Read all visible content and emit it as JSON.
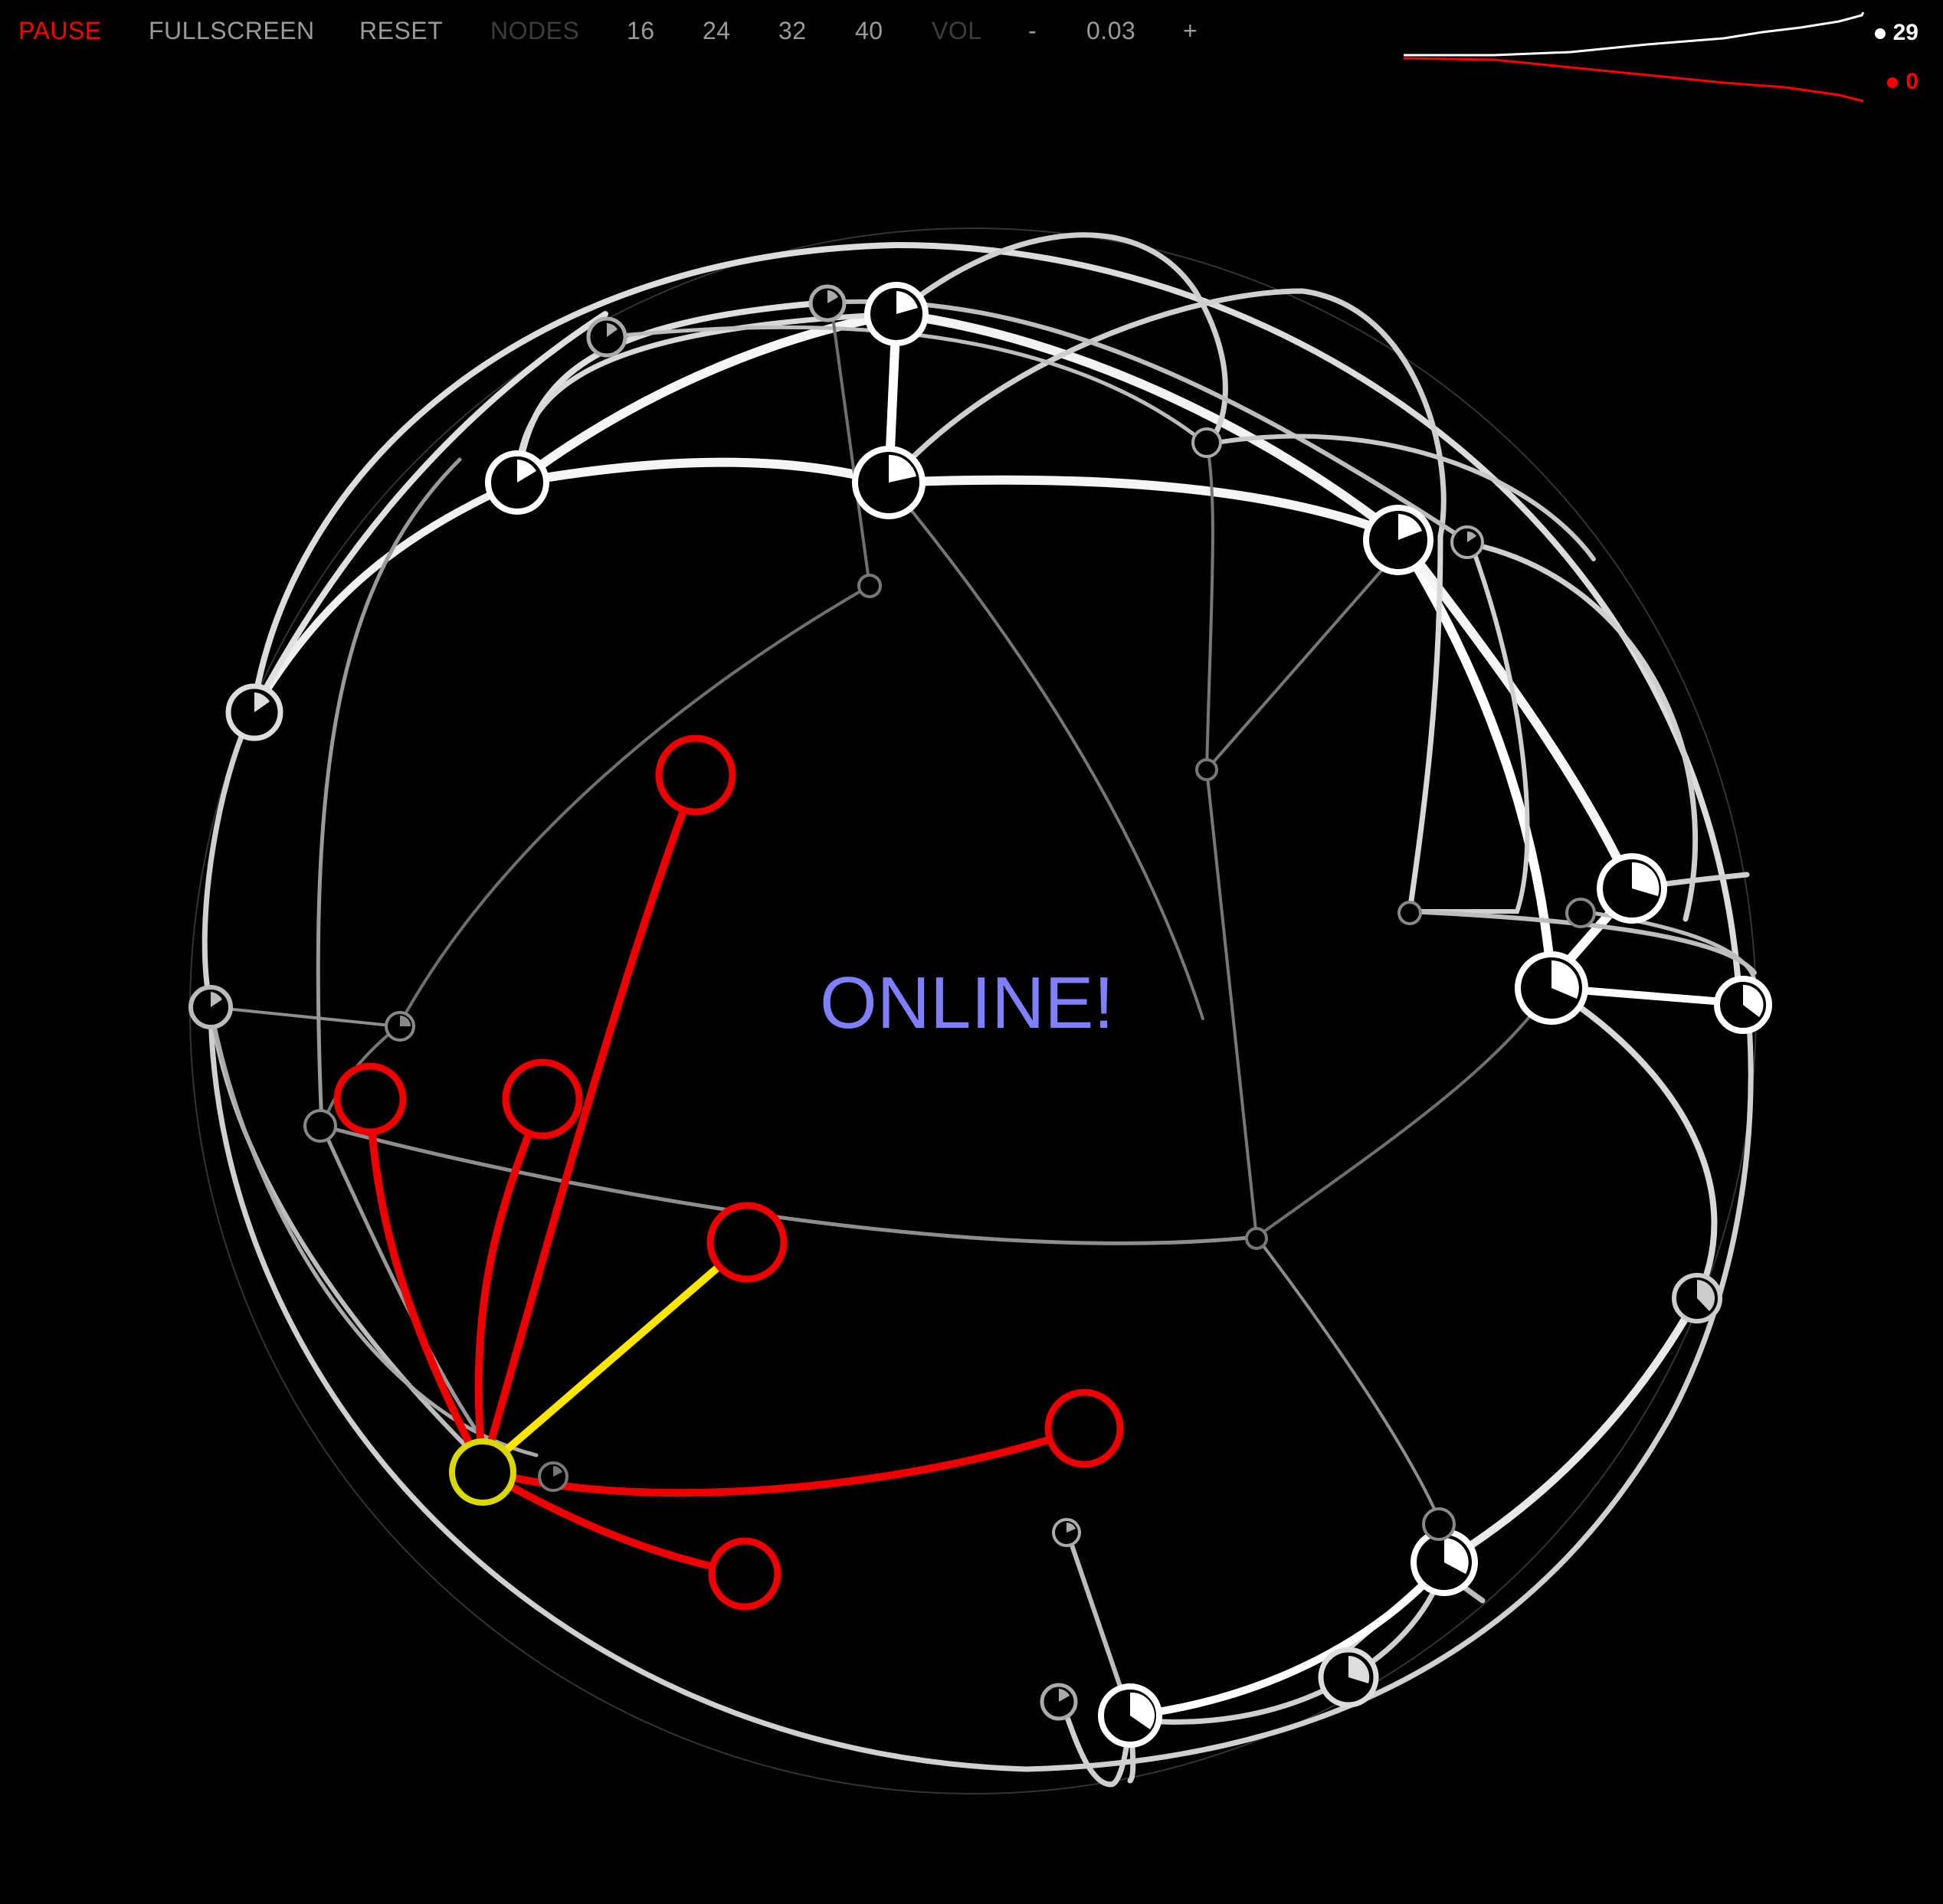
{
  "toolbar": {
    "pause": "PAUSE",
    "fullscreen": "FULLSCREEN",
    "reset": "RESET",
    "nodes_label": "NODES",
    "node_options": [
      "16",
      "24",
      "32",
      "40"
    ],
    "vol_label": "VOL",
    "vol_minus": "-",
    "vol_value": "0.03",
    "vol_plus": "+"
  },
  "stats": {
    "online_count": "29",
    "offline_count": "0"
  },
  "status": "ONLINE!",
  "colors": {
    "background": "#000000",
    "active": "#ff0000",
    "online": "#ffffff",
    "offline": "#ff0000",
    "selected": "#ffe600",
    "status_text": "#8080ff"
  }
}
